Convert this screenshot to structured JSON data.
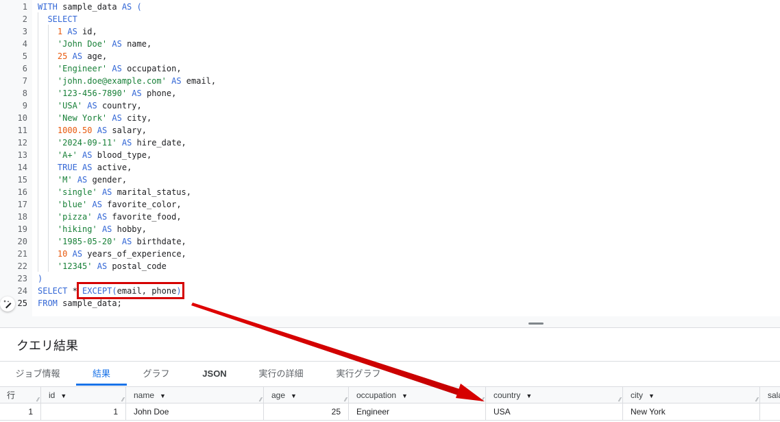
{
  "editor": {
    "lines": [
      {
        "n": "1",
        "tokens": [
          {
            "t": "kw",
            "v": "WITH"
          },
          {
            "t": "id",
            "v": " sample_data "
          },
          {
            "t": "kw",
            "v": "AS ("
          }
        ]
      },
      {
        "n": "2",
        "tokens": [
          {
            "t": "id",
            "v": "  "
          },
          {
            "t": "kw",
            "v": "SELECT"
          }
        ]
      },
      {
        "n": "3",
        "tokens": [
          {
            "t": "id",
            "v": "    "
          },
          {
            "t": "num",
            "v": "1"
          },
          {
            "t": "id",
            "v": " "
          },
          {
            "t": "kw",
            "v": "AS"
          },
          {
            "t": "id",
            "v": " id,"
          }
        ]
      },
      {
        "n": "4",
        "tokens": [
          {
            "t": "id",
            "v": "    "
          },
          {
            "t": "str",
            "v": "'John Doe'"
          },
          {
            "t": "id",
            "v": " "
          },
          {
            "t": "kw",
            "v": "AS"
          },
          {
            "t": "id",
            "v": " name,"
          }
        ]
      },
      {
        "n": "5",
        "tokens": [
          {
            "t": "id",
            "v": "    "
          },
          {
            "t": "num",
            "v": "25"
          },
          {
            "t": "id",
            "v": " "
          },
          {
            "t": "kw",
            "v": "AS"
          },
          {
            "t": "id",
            "v": " age,"
          }
        ]
      },
      {
        "n": "6",
        "tokens": [
          {
            "t": "id",
            "v": "    "
          },
          {
            "t": "str",
            "v": "'Engineer'"
          },
          {
            "t": "id",
            "v": " "
          },
          {
            "t": "kw",
            "v": "AS"
          },
          {
            "t": "id",
            "v": " occupation,"
          }
        ]
      },
      {
        "n": "7",
        "tokens": [
          {
            "t": "id",
            "v": "    "
          },
          {
            "t": "str",
            "v": "'john.doe@example.com'"
          },
          {
            "t": "id",
            "v": " "
          },
          {
            "t": "kw",
            "v": "AS"
          },
          {
            "t": "id",
            "v": " email,"
          }
        ]
      },
      {
        "n": "8",
        "tokens": [
          {
            "t": "id",
            "v": "    "
          },
          {
            "t": "str",
            "v": "'123-456-7890'"
          },
          {
            "t": "id",
            "v": " "
          },
          {
            "t": "kw",
            "v": "AS"
          },
          {
            "t": "id",
            "v": " phone,"
          }
        ]
      },
      {
        "n": "9",
        "tokens": [
          {
            "t": "id",
            "v": "    "
          },
          {
            "t": "str",
            "v": "'USA'"
          },
          {
            "t": "id",
            "v": " "
          },
          {
            "t": "kw",
            "v": "AS"
          },
          {
            "t": "id",
            "v": " country,"
          }
        ]
      },
      {
        "n": "10",
        "tokens": [
          {
            "t": "id",
            "v": "    "
          },
          {
            "t": "str",
            "v": "'New York'"
          },
          {
            "t": "id",
            "v": " "
          },
          {
            "t": "kw",
            "v": "AS"
          },
          {
            "t": "id",
            "v": " city,"
          }
        ]
      },
      {
        "n": "11",
        "tokens": [
          {
            "t": "id",
            "v": "    "
          },
          {
            "t": "num",
            "v": "1000.50"
          },
          {
            "t": "id",
            "v": " "
          },
          {
            "t": "kw",
            "v": "AS"
          },
          {
            "t": "id",
            "v": " salary,"
          }
        ]
      },
      {
        "n": "12",
        "tokens": [
          {
            "t": "id",
            "v": "    "
          },
          {
            "t": "str",
            "v": "'2024-09-11'"
          },
          {
            "t": "id",
            "v": " "
          },
          {
            "t": "kw",
            "v": "AS"
          },
          {
            "t": "id",
            "v": " hire_date,"
          }
        ]
      },
      {
        "n": "13",
        "tokens": [
          {
            "t": "id",
            "v": "    "
          },
          {
            "t": "str",
            "v": "'A+'"
          },
          {
            "t": "id",
            "v": " "
          },
          {
            "t": "kw",
            "v": "AS"
          },
          {
            "t": "id",
            "v": " blood_type,"
          }
        ]
      },
      {
        "n": "14",
        "tokens": [
          {
            "t": "id",
            "v": "    "
          },
          {
            "t": "kw",
            "v": "TRUE"
          },
          {
            "t": "id",
            "v": " "
          },
          {
            "t": "kw",
            "v": "AS"
          },
          {
            "t": "id",
            "v": " active,"
          }
        ]
      },
      {
        "n": "15",
        "tokens": [
          {
            "t": "id",
            "v": "    "
          },
          {
            "t": "str",
            "v": "'M'"
          },
          {
            "t": "id",
            "v": " "
          },
          {
            "t": "kw",
            "v": "AS"
          },
          {
            "t": "id",
            "v": " gender,"
          }
        ]
      },
      {
        "n": "16",
        "tokens": [
          {
            "t": "id",
            "v": "    "
          },
          {
            "t": "str",
            "v": "'single'"
          },
          {
            "t": "id",
            "v": " "
          },
          {
            "t": "kw",
            "v": "AS"
          },
          {
            "t": "id",
            "v": " marital_status,"
          }
        ]
      },
      {
        "n": "17",
        "tokens": [
          {
            "t": "id",
            "v": "    "
          },
          {
            "t": "str",
            "v": "'blue'"
          },
          {
            "t": "id",
            "v": " "
          },
          {
            "t": "kw",
            "v": "AS"
          },
          {
            "t": "id",
            "v": " favorite_color,"
          }
        ]
      },
      {
        "n": "18",
        "tokens": [
          {
            "t": "id",
            "v": "    "
          },
          {
            "t": "str",
            "v": "'pizza'"
          },
          {
            "t": "id",
            "v": " "
          },
          {
            "t": "kw",
            "v": "AS"
          },
          {
            "t": "id",
            "v": " favorite_food,"
          }
        ]
      },
      {
        "n": "19",
        "tokens": [
          {
            "t": "id",
            "v": "    "
          },
          {
            "t": "str",
            "v": "'hiking'"
          },
          {
            "t": "id",
            "v": " "
          },
          {
            "t": "kw",
            "v": "AS"
          },
          {
            "t": "id",
            "v": " hobby,"
          }
        ]
      },
      {
        "n": "20",
        "tokens": [
          {
            "t": "id",
            "v": "    "
          },
          {
            "t": "str",
            "v": "'1985-05-20'"
          },
          {
            "t": "id",
            "v": " "
          },
          {
            "t": "kw",
            "v": "AS"
          },
          {
            "t": "id",
            "v": " birthdate,"
          }
        ]
      },
      {
        "n": "21",
        "tokens": [
          {
            "t": "id",
            "v": "    "
          },
          {
            "t": "num",
            "v": "10"
          },
          {
            "t": "id",
            "v": " "
          },
          {
            "t": "kw",
            "v": "AS"
          },
          {
            "t": "id",
            "v": " years_of_experience,"
          }
        ]
      },
      {
        "n": "22",
        "tokens": [
          {
            "t": "id",
            "v": "    "
          },
          {
            "t": "str",
            "v": "'12345'"
          },
          {
            "t": "id",
            "v": " "
          },
          {
            "t": "kw",
            "v": "AS"
          },
          {
            "t": "id",
            "v": " postal_code"
          }
        ]
      },
      {
        "n": "23",
        "tokens": [
          {
            "t": "kw",
            "v": ")"
          }
        ]
      },
      {
        "n": "24",
        "tokens": [
          {
            "t": "kw",
            "v": "SELECT"
          },
          {
            "t": "id",
            "v": " * "
          },
          {
            "t": "kw",
            "v": "EXCEPT("
          },
          {
            "t": "id",
            "v": "email, phone"
          },
          {
            "t": "kw",
            "v": ")"
          }
        ]
      },
      {
        "n": "25",
        "tokens": [
          {
            "t": "kw",
            "v": "FROM"
          },
          {
            "t": "id",
            "v": " sample_data;"
          }
        ]
      }
    ],
    "active_line": "25",
    "ai_assist_icon": "pen-sparkle-icon"
  },
  "annotation": {
    "highlight_color": "#d50000",
    "arrow_color": "#e00000"
  },
  "results": {
    "title": "クエリ結果",
    "tabs": [
      {
        "label": "ジョブ情報",
        "active": false
      },
      {
        "label": "結果",
        "active": true
      },
      {
        "label": "グラフ",
        "active": false
      },
      {
        "label": "JSON",
        "active": false
      },
      {
        "label": "実行の詳細",
        "active": false
      },
      {
        "label": "実行グラフ",
        "active": false
      }
    ],
    "table": {
      "row_header": "行",
      "columns": [
        "id",
        "name",
        "age",
        "occupation",
        "country",
        "city",
        "sala"
      ],
      "rows": [
        {
          "row": "1",
          "cells": [
            "1",
            "John Doe",
            "25",
            "Engineer",
            "USA",
            "New York",
            ""
          ]
        }
      ]
    }
  },
  "colors": {
    "accent": "#1a73e8",
    "keyword": "#3367d6",
    "string": "#188038",
    "number": "#e8590c"
  }
}
